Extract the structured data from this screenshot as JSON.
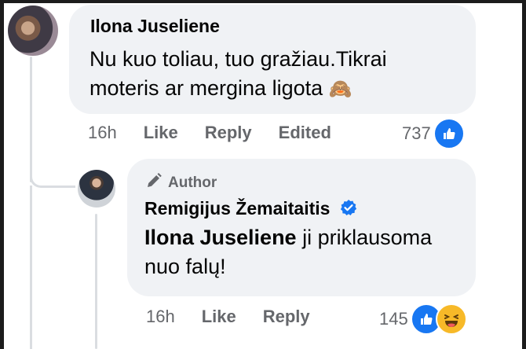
{
  "comment": {
    "author": "Ilona Juseliene",
    "text": "Nu kuo toliau, tuo gražiau.Tikrai moteris ar mergina ligota",
    "emoji": "🙈",
    "time": "16h",
    "like_label": "Like",
    "reply_label": "Reply",
    "edited_label": "Edited",
    "reaction_count": "737"
  },
  "reply": {
    "badge": "Author",
    "author": "Remigijus Žemaitaitis",
    "mention": "Ilona Juseliene",
    "text": " ji priklausoma nuo falų!",
    "time": "16h",
    "like_label": "Like",
    "reply_label": "Reply",
    "reaction_count": "145"
  },
  "colors": {
    "bubble": "#f0f2f5",
    "meta_text": "#65676b",
    "like_blue": "#1877f2",
    "haha_yellow": "#f7b928"
  },
  "icons": {
    "verified": "verified-badge-icon",
    "author_badge": "pen-icon",
    "like": "thumbs-up-icon",
    "haha": "laughing-face-icon"
  }
}
